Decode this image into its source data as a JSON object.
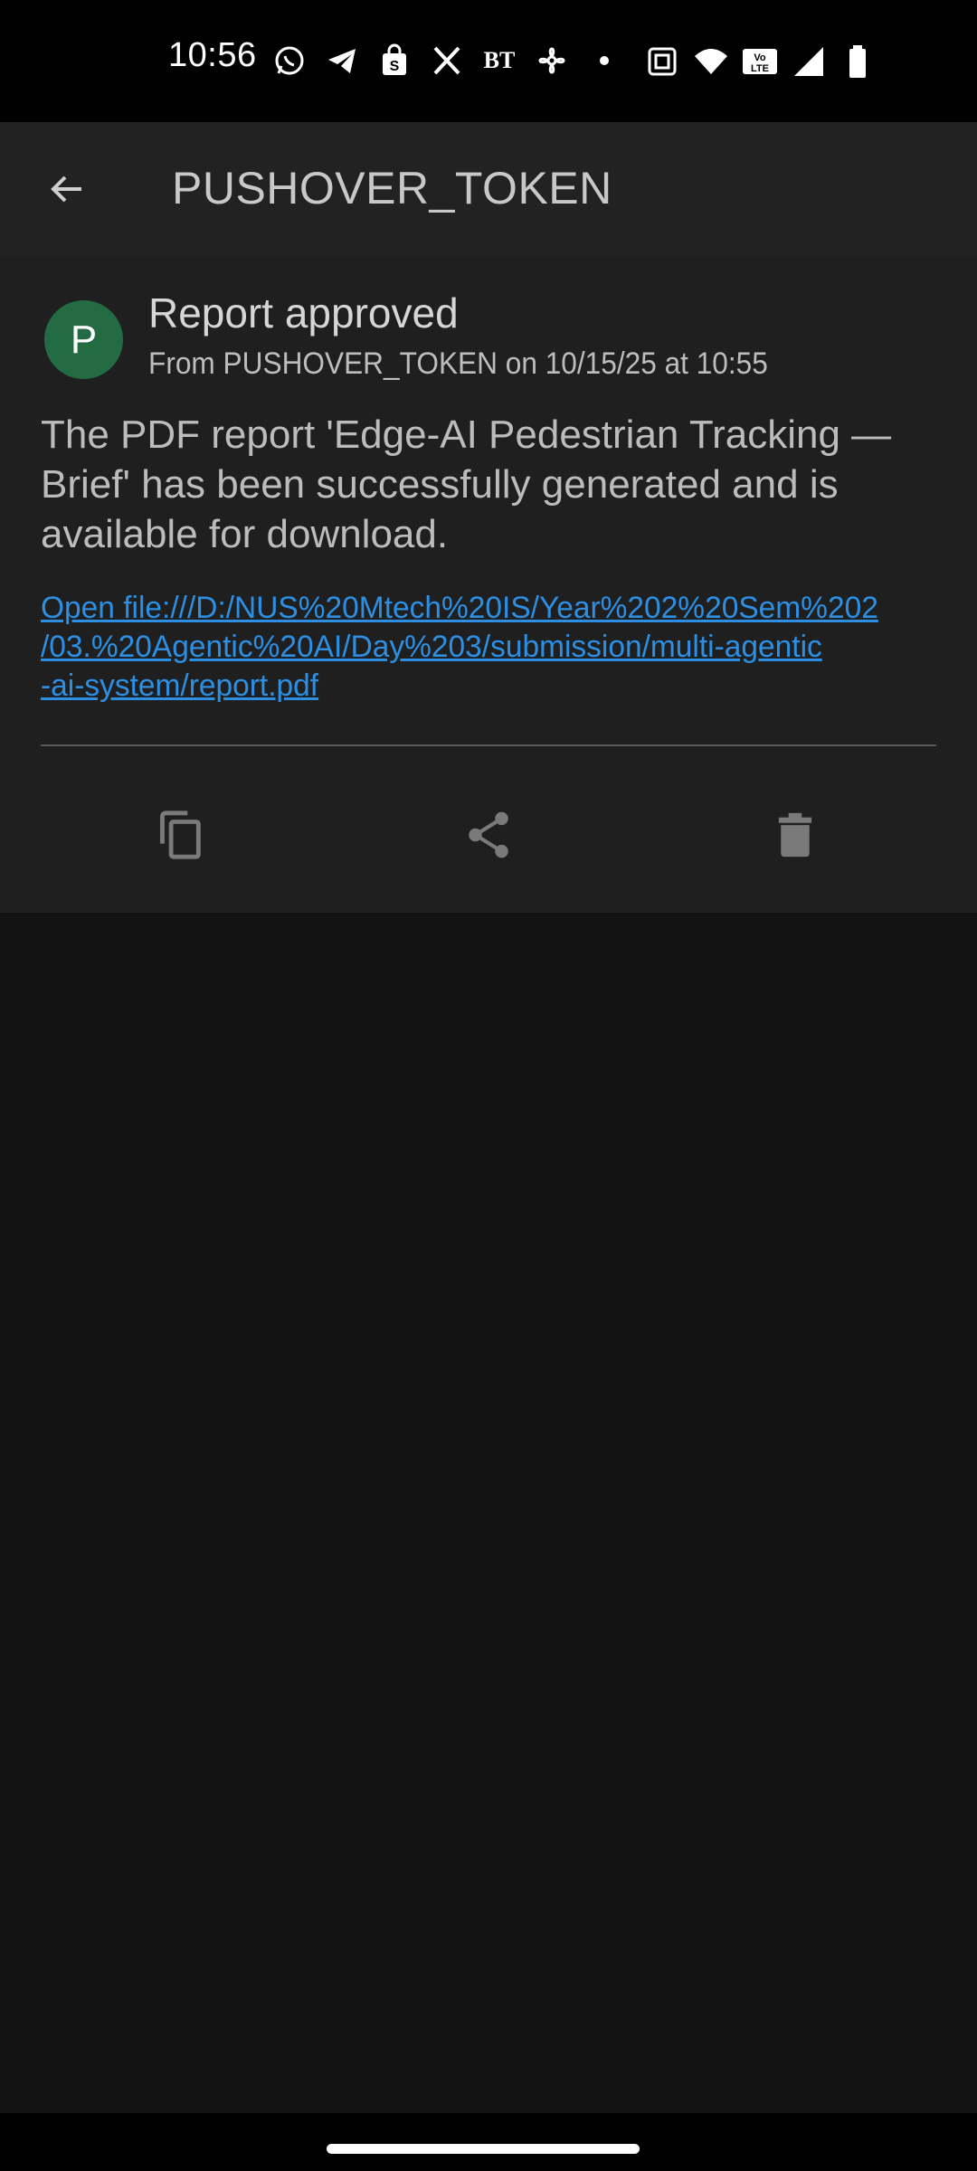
{
  "status_bar": {
    "time": "10:56",
    "notification_icons": [
      "whatsapp-icon",
      "telegram-icon",
      "shopping-bag-icon",
      "x-icon",
      "bt-icon",
      "fan-icon",
      "more-dot-icon"
    ],
    "bt_text": "BT",
    "system_icons": [
      "nfc-icon",
      "wifi-icon",
      "volte-icon",
      "cellular-signal-icon",
      "battery-icon"
    ],
    "volte_text": "Vo LTE"
  },
  "app_bar": {
    "title": "PUSHOVER_TOKEN"
  },
  "message": {
    "avatar_letter": "P",
    "avatar_color": "#236b42",
    "title": "Report approved",
    "from_line": "From PUSHOVER_TOKEN on 10/15/25 at 10:55",
    "body": "The PDF report 'Edge-AI Pedestrian Tracking — Brief' has been successfully generated and is available for download.",
    "link_text": "Open file:///D:/NUS%20Mtech%20IS/Year%202%20Sem%202\n/03.%20Agentic%20AI/Day%203/submission/multi-agentic\n-ai-system/report.pdf",
    "link_color": "#2d8fe3"
  },
  "actions": {
    "copy": "copy-icon",
    "share": "share-icon",
    "delete": "delete-icon"
  }
}
